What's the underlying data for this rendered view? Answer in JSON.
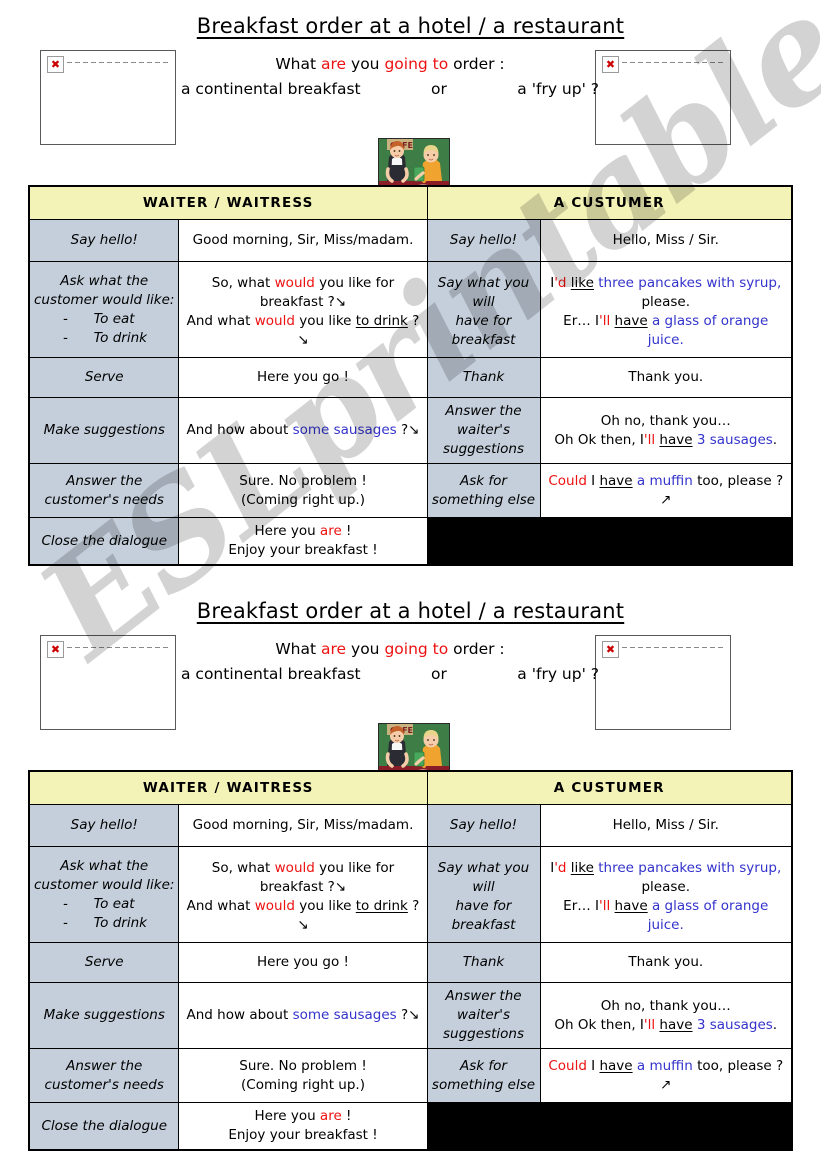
{
  "watermark": "ESLprintables.com",
  "worksheet": {
    "title": "Breakfast order at a hotel / a restaurant",
    "intro": {
      "line1_a": "What ",
      "line1_are": "are",
      "line1_b": " you ",
      "line1_going": "going to",
      "line1_c": " order :",
      "line2_left": "a continental breakfast",
      "line2_mid": "or",
      "line2_right": "a 'fry up' ?"
    },
    "images": {
      "left_placeholder": "broken-image",
      "right_placeholder": "broken-image",
      "center_illustration": "waitress-serving-customer"
    },
    "table": {
      "headers": {
        "waiter": "WAITER / WAITRESS",
        "customer": "A CUSTUMER"
      },
      "rows": [
        {
          "waiter_cue": "Say hello!",
          "waiter_say": "Good morning, Sir, Miss/madam.",
          "customer_cue": "Say hello!",
          "customer_say": "Hello, Miss / Sir."
        },
        {
          "waiter_cue_main": "Ask what the",
          "waiter_cue_main2": "customer would like:",
          "waiter_cue_item1": "-      To eat",
          "waiter_cue_item2": "-      To drink",
          "waiter_say_l1a": "So, what ",
          "waiter_say_l1_would": "would",
          "waiter_say_l1b": " you like for",
          "waiter_say_l2": "breakfast ?↘",
          "waiter_say_l3a": "And what ",
          "waiter_say_l3_would": "would",
          "waiter_say_l3b": " you like ",
          "waiter_say_l3_drink": "to drink",
          "waiter_say_l3c": " ?↘",
          "customer_cue_l1": "Say what you will",
          "customer_cue_l2": "have for",
          "customer_cue_l3": "breakfast",
          "customer_say_l1_i": "I",
          "customer_say_l1_d": "'d",
          "customer_say_l1_like": "like",
          "customer_say_l1_blue": "three pancakes with syrup,",
          "customer_say_l2": "please.",
          "customer_say_l3_er": "Er… I",
          "customer_say_l3_ll": "'ll",
          "customer_say_l3_have": "have",
          "customer_say_l3_blue": "a glass of orange juice."
        },
        {
          "waiter_cue": "Serve",
          "waiter_say": "Here you go !",
          "customer_cue": "Thank",
          "customer_say": "Thank you."
        },
        {
          "waiter_cue": "Make suggestions",
          "waiter_say_a": "And how about ",
          "waiter_say_blue": "some sausages",
          "waiter_say_b": " ?↘",
          "customer_cue_l1": "Answer the",
          "customer_cue_l2": "waiter's",
          "customer_cue_l3": "suggestions",
          "customer_say_l1": "Oh no, thank you…",
          "customer_say_l2a": "Oh Ok then, I",
          "customer_say_l2_ll": "'ll",
          "customer_say_l2_have": "have",
          "customer_say_l2_blue": "3 sausages",
          "customer_say_l2b": "."
        },
        {
          "waiter_cue_l1": "Answer the",
          "waiter_cue_l2": "customer's needs",
          "waiter_say_l1": "Sure. No problem !",
          "waiter_say_l2": "(Coming right up.)",
          "customer_cue_l1": "Ask for",
          "customer_cue_l2": "something else",
          "customer_say_could": "Could",
          "customer_say_a": " I ",
          "customer_say_have": "have",
          "customer_say_blue": "a muffin",
          "customer_say_b": " too, please ? ↗"
        },
        {
          "waiter_cue": "Close the dialogue",
          "waiter_say_l1a": "Here you ",
          "waiter_say_l1_are": "are",
          "waiter_say_l1b": " !",
          "waiter_say_l2": "Enjoy your breakfast !",
          "customer_cue": "",
          "customer_say": ""
        }
      ]
    }
  },
  "colors": {
    "header_bg": "#f3f3b7",
    "header_text": "#9b4f9b",
    "cue_bg": "#c4cfdb",
    "accent_red": "#ee1111",
    "accent_blue": "#3333cc",
    "blank_cell": "#000000"
  }
}
